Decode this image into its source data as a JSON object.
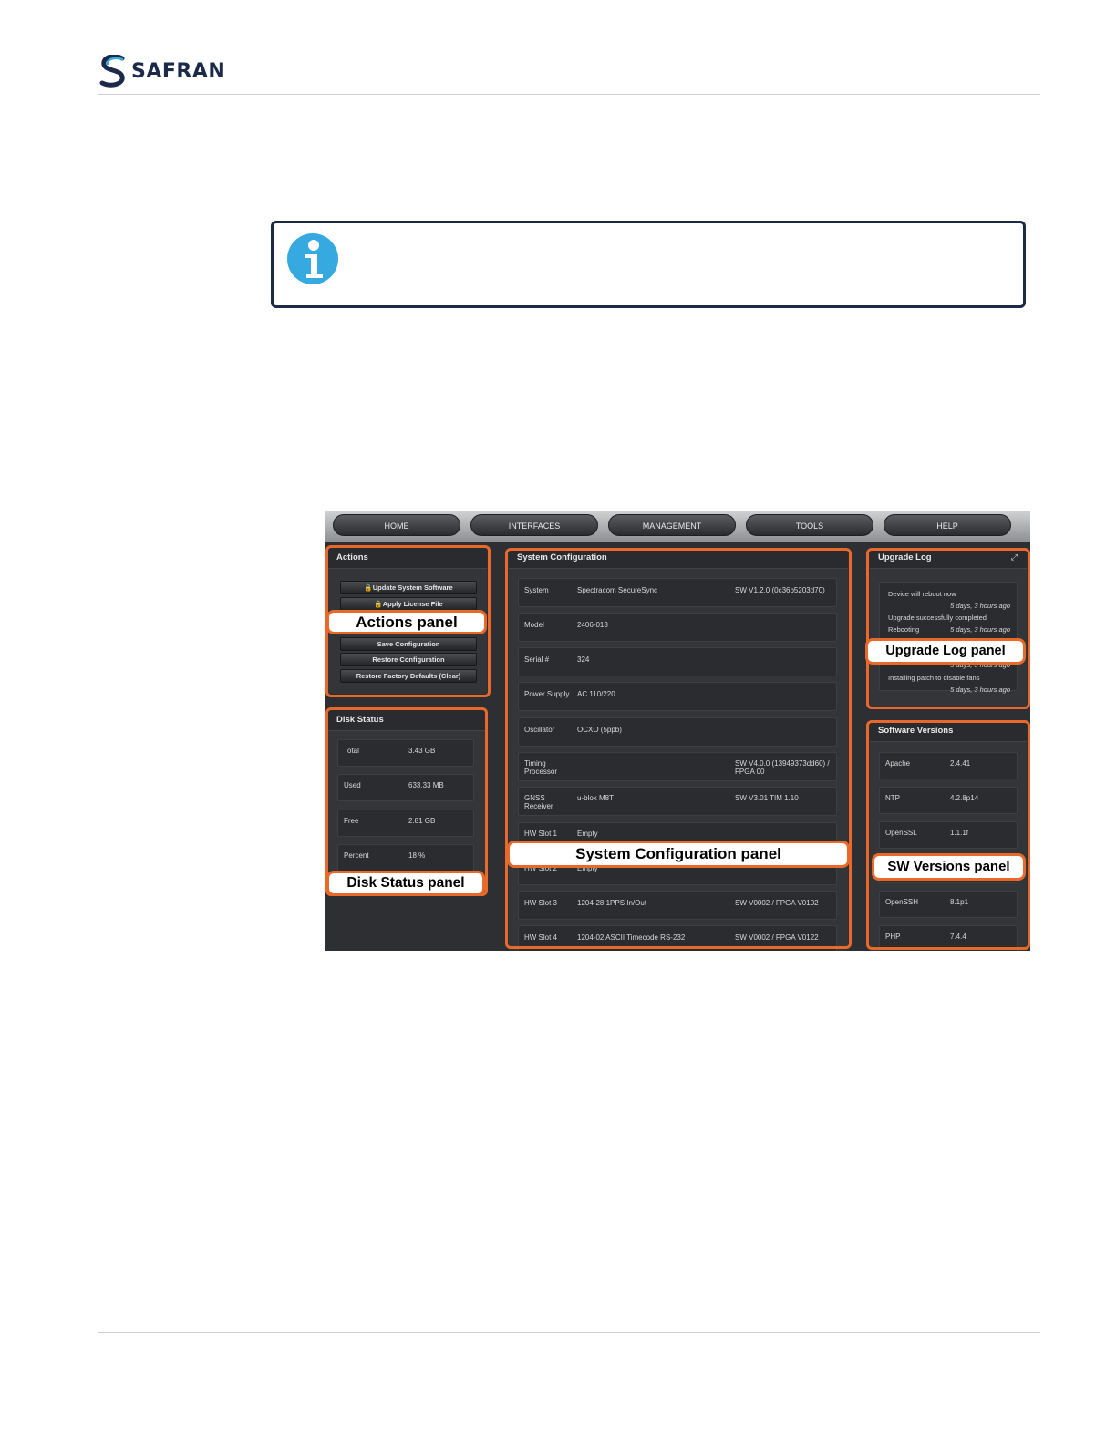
{
  "header": {
    "logo_text": "SAFRAN"
  },
  "note": {
    "icon": "info-icon",
    "icon_color": "#36a9e1"
  },
  "screenshot": {
    "nav": [
      "HOME",
      "INTERFACES",
      "MANAGEMENT",
      "TOOLS",
      "HELP"
    ],
    "actions": {
      "title": "Actions",
      "buttons": [
        "🔒Update System Software",
        "🔒Apply License File",
        "Save Configuration",
        "Restore Configuration",
        "Restore Factory Defaults (Clear)"
      ]
    },
    "disk_status": {
      "title": "Disk Status",
      "rows": [
        {
          "label": "Total",
          "value": "3.43 GB"
        },
        {
          "label": "Used",
          "value": "633.33 MB"
        },
        {
          "label": "Free",
          "value": "2.81 GB"
        },
        {
          "label": "Percent",
          "value": "18 %"
        }
      ]
    },
    "system_configuration": {
      "title": "System Configuration",
      "rows": [
        {
          "label": "System",
          "value": "Spectracom SecureSync",
          "extra": "SW V1.2.0 (0c36b5203d70)"
        },
        {
          "label": "Model",
          "value": "2406-013",
          "extra": ""
        },
        {
          "label": "Serial #",
          "value": "324",
          "extra": ""
        },
        {
          "label": "Power Supply",
          "value": "AC 110/220",
          "extra": ""
        },
        {
          "label": "Oscillator",
          "value": "OCXO (5ppb)",
          "extra": ""
        },
        {
          "label": "Timing Processor",
          "value": "",
          "extra": "SW V4.0.0 (13949373dd60) / FPGA 00"
        },
        {
          "label": "GNSS Receiver",
          "value": "u-blox M8T",
          "extra": "SW V3.01 TIM 1.10"
        },
        {
          "label": "HW Slot 1",
          "value": "Empty",
          "extra": ""
        },
        {
          "label": "HW Slot 2",
          "value": "Empty",
          "extra": ""
        },
        {
          "label": "HW Slot 3",
          "value": "1204-28 1PPS In/Out",
          "extra": "SW V0002 / FPGA V0102"
        },
        {
          "label": "HW Slot 4",
          "value": "1204-02 ASCII Timecode RS-232",
          "extra": "SW V0002 / FPGA V0122"
        }
      ]
    },
    "upgrade_log": {
      "title": "Upgrade Log",
      "items": [
        {
          "text": "Device will reboot now",
          "time": "5 days, 3 hours ago"
        },
        {
          "text": "Upgrade successfully completed",
          "time": ""
        },
        {
          "text": "Rebooting",
          "time": "5 days, 3 hours ago"
        },
        {
          "text": "",
          "time": "5 days, 3 hours ago"
        },
        {
          "text": "Installing patch to disable fans",
          "time": "5 days, 3 hours ago"
        }
      ]
    },
    "software_versions": {
      "title": "Software Versions",
      "rows": [
        {
          "label": "Apache",
          "value": "2.4.41"
        },
        {
          "label": "NTP",
          "value": "4.2.8p14"
        },
        {
          "label": "OpenSSL",
          "value": "1.1.1f"
        },
        {
          "label": "",
          "value": ""
        },
        {
          "label": "OpenSSH",
          "value": "8.1p1"
        },
        {
          "label": "PHP",
          "value": "7.4.4"
        }
      ]
    },
    "callouts": {
      "actions": "Actions panel",
      "disk": "Disk Status panel",
      "sysconfig": "System Configuration panel",
      "upgrade": "Upgrade Log panel",
      "sw": "SW Versions panel"
    },
    "highlight_color": "#e8692a"
  }
}
